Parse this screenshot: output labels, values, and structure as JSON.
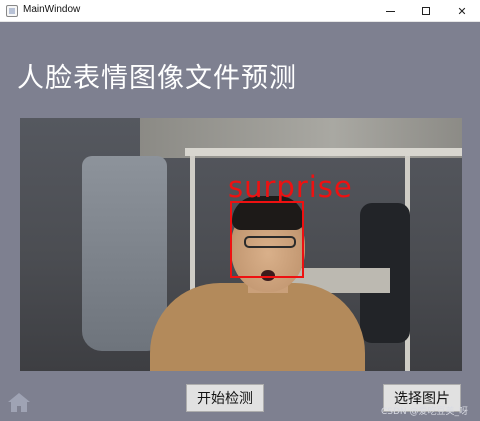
{
  "window": {
    "title": "MainWindow",
    "controls": {
      "minimize_icon": "minimize-icon",
      "maximize_icon": "maximize-icon",
      "close_glyph": "✕"
    }
  },
  "heading": "人脸表情图像文件预测",
  "detection": {
    "emotion_label": "surprise",
    "box_color": "#ee1111"
  },
  "buttons": {
    "start": "开始检测",
    "select": "选择图片"
  },
  "watermark": "CSDN @爱吃豆美_呀",
  "colors": {
    "client_background": "#7e8090",
    "heading_text": "#ffffff"
  },
  "icons": [
    "app-icon",
    "home-icon"
  ]
}
